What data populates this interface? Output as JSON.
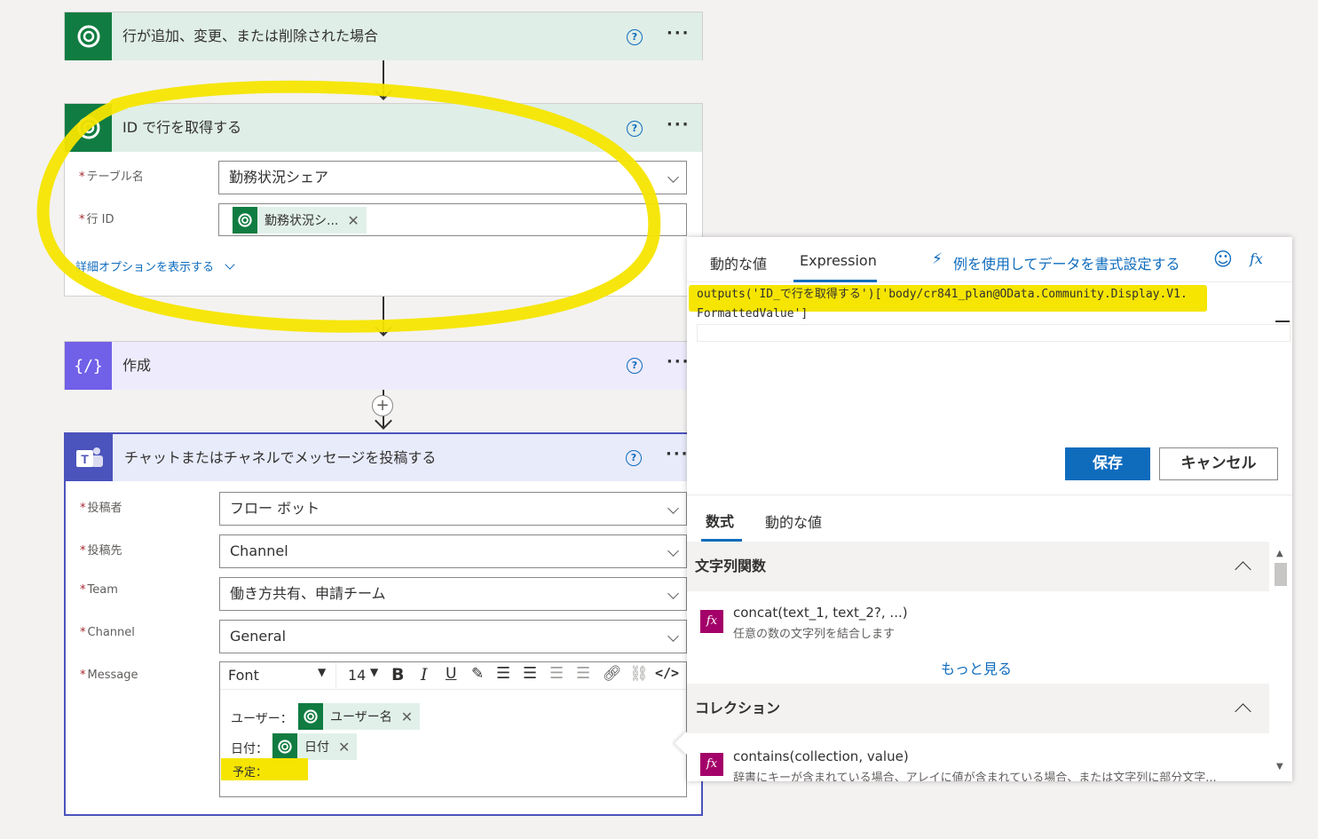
{
  "step1": {
    "title": "行が追加、変更、または削除された場合"
  },
  "step2": {
    "title": "ID で行を取得する",
    "table_label": "テーブル名",
    "table_value": "勤務状況シェア",
    "row_label": "行 ID",
    "row_token": "勤務状況シ...",
    "advanced_link": "詳細オプションを表示する"
  },
  "step3": {
    "title": "作成"
  },
  "step4": {
    "title": "チャットまたはチャネルでメッセージを投稿する",
    "poster_label": "投稿者",
    "poster_value": "フロー ボット",
    "target_label": "投稿先",
    "target_value": "Channel",
    "team_label": "Team",
    "team_value": "働き方共有、申請チーム",
    "channel_label": "Channel",
    "channel_value": "General",
    "message_label": "Message",
    "toolbar": {
      "font": "Font",
      "size": "14"
    },
    "line_user_label": "ユーザー：",
    "line_user_token": "ユーザー名",
    "line_date_label": "日付：",
    "line_date_token": "日付",
    "line_plan_label": "予定："
  },
  "panel": {
    "tab_dynamic": "動的な値",
    "tab_expression": "Expression",
    "format_link": "例を使用してデータを書式設定する",
    "expression_line1": "outputs('ID_で行を取得する')['body/cr841_plan@OData.Community.Display.V1.",
    "expression_line2": "FormattedValue']",
    "save": "保存",
    "cancel": "キャンセル",
    "lower_tab_formula": "数式",
    "lower_tab_dynamic": "動的な値",
    "section_string": "文字列関数",
    "fn1_name": "concat(text_1, text_2?, ...)",
    "fn1_desc": "任意の数の文字列を結合します",
    "more": "もっと見る",
    "section_collection": "コレクション",
    "fn2_name": "contains(collection, value)",
    "fn2_desc": "辞書にキーが含まれている場合、アレイに値が含まれている場合、または文字列に部分文字..."
  },
  "colors": {
    "dataverse": "#107c41",
    "compose": "#7160e8",
    "teams": "#4b53bc",
    "accent": "#0f6cbd",
    "highlight": "#f5e500"
  }
}
